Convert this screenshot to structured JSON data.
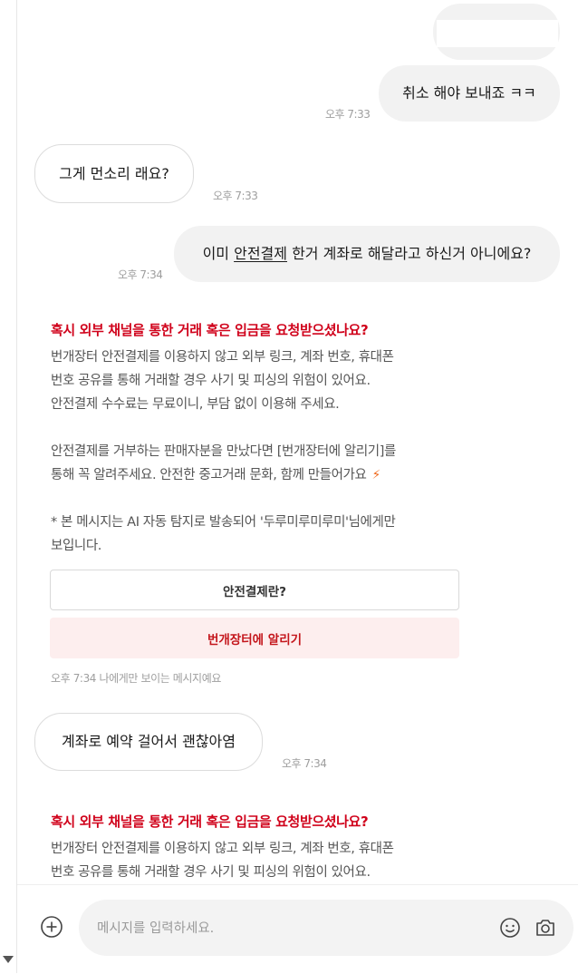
{
  "messages": [
    {
      "side": "out",
      "text": "",
      "time": ""
    },
    {
      "side": "out",
      "text": "취소 해야 보내죠 ㅋㅋ",
      "time": "오후 7:33"
    },
    {
      "side": "in",
      "text": "그게 먼소리 래요?",
      "time": "오후 7:33"
    },
    {
      "side": "out",
      "text_before": "이미 ",
      "text_underlined": "안전결제",
      "text_after": " 한거 계좌로 해달라고 하신거 아니에요?",
      "time": "오후 7:34"
    },
    {
      "side": "in",
      "text": "계좌로 예약 걸어서 괜찮아염",
      "time": "오후 7:34"
    }
  ],
  "safety_notice": {
    "title": "혹시 외부 채널을 통한 거래 혹은 입금을 요청받으셨나요?",
    "lines": [
      "번개장터 안전결제를 이용하지 않고 외부 링크, 계좌 번호, 휴대폰",
      "번호 공유를 통해 거래할 경우 사기 및 피싱의 위험이 있어요.",
      "안전결제 수수료는 무료이니, 부담 없이 이용해 주세요.",
      "안전결제를 거부하는 판매자분을 만났다면 [번개장터에 알리기]를",
      "통해 꼭 알려주세요. 안전한 중고거래 문화, 함께 만들어가요",
      "* 본 메시지는 AI 자동 탐지로 발송되어 '두루미루미루미'님에게만",
      "보입니다."
    ],
    "button_safe_payment": "안전결제란?",
    "button_report": "번개장터에 알리기",
    "footer_time": "오후 7:34",
    "footer_note": "나에게만 보이는 메시지예요",
    "bolt_icon": "lightning-icon"
  },
  "safety_notice_repeat": {
    "title": "혹시 외부 채널을 통한 거래 혹은 입금을 요청받으셨나요?",
    "lines": [
      "번개장터 안전결제를 이용하지 않고 외부 링크, 계좌 번호, 휴대폰",
      "번호 공유를 통해 거래할 경우 사기 및 피싱의 위험이 있어요."
    ]
  },
  "composer": {
    "placeholder": "메시지를 입력하세요.",
    "icons": [
      "plus-circle-icon",
      "emoji-icon",
      "camera-icon"
    ]
  },
  "colors": {
    "accent_red": "#d0021b",
    "report_bg": "#fdeeee",
    "bubble_out_bg": "#f2f2f2"
  }
}
